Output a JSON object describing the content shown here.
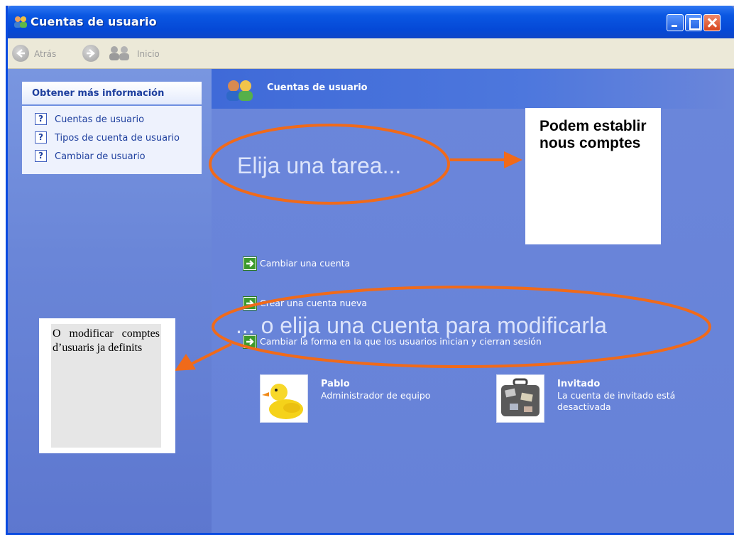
{
  "window": {
    "title": "Cuentas de usuario",
    "accent": "#0a57e2"
  },
  "toolbar": {
    "back_label": "Atrás",
    "home_label": "Inicio"
  },
  "sidebar": {
    "header": "Obtener más información",
    "items": [
      {
        "label": "Cuentas de usuario",
        "icon": "help-icon"
      },
      {
        "label": "Tipos de cuenta de usuario",
        "icon": "help-icon"
      },
      {
        "label": "Cambiar de usuario",
        "icon": "help-icon"
      }
    ]
  },
  "main": {
    "header_title": "Cuentas de usuario",
    "task_heading": "Elija una tarea...",
    "tasks": [
      {
        "label": "Cambiar una cuenta"
      },
      {
        "label": "Crear una cuenta nueva"
      },
      {
        "label": "Cambiar la forma en la que los usuarios inician y cierran sesión"
      }
    ],
    "accounts_heading": "... o elija una cuenta para modificarla",
    "accounts": [
      {
        "name": "Pablo",
        "description": "Administrador de equipo",
        "picture": "duck-picture"
      },
      {
        "name": "Invitado",
        "description": "La cuenta de invitado está desactivada",
        "picture": "suitcase-picture"
      }
    ]
  },
  "annotations": {
    "note_right": "Podem establir nous comptes",
    "note_left": "O modificar comptes d’usuaris ja definits",
    "highlight_color": "#f06a1a"
  }
}
